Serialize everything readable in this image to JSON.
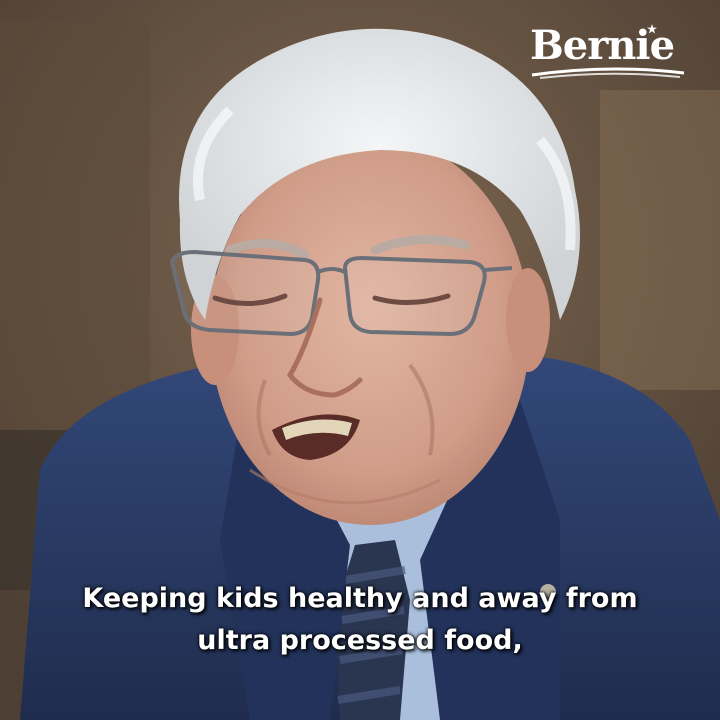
{
  "logo": {
    "text": "Bernie",
    "color": "#ffffff"
  },
  "caption": {
    "line1": "Keeping kids healthy and away from",
    "line2": "ultra processed food,"
  },
  "scene": {
    "subject": "older man with white hair and glasses speaking",
    "colors": {
      "background": "#6e5844",
      "suit": "#2b3c66",
      "shirt": "#a9bfdc",
      "hair": "#e9ecef",
      "skin": "#d9aa96",
      "tie": "#2a3550"
    }
  }
}
